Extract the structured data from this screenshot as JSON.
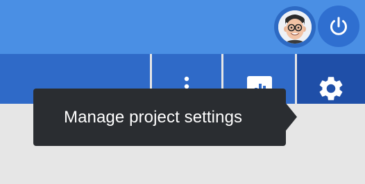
{
  "header": {
    "avatar_name": "user-avatar",
    "power_icon": "power-icon"
  },
  "toolbar": {
    "items": [
      {
        "icon": "blank"
      },
      {
        "icon": "kebab-menu-icon"
      },
      {
        "icon": "bar-chart-icon"
      },
      {
        "icon": "gear-icon"
      }
    ]
  },
  "tooltip": {
    "text": "Manage project settings"
  },
  "colors": {
    "top_bar": "#4a8fe4",
    "toolbar": "#2f6ac8",
    "active_item": "#1f4fa8",
    "tooltip_bg": "#2a2d31"
  }
}
